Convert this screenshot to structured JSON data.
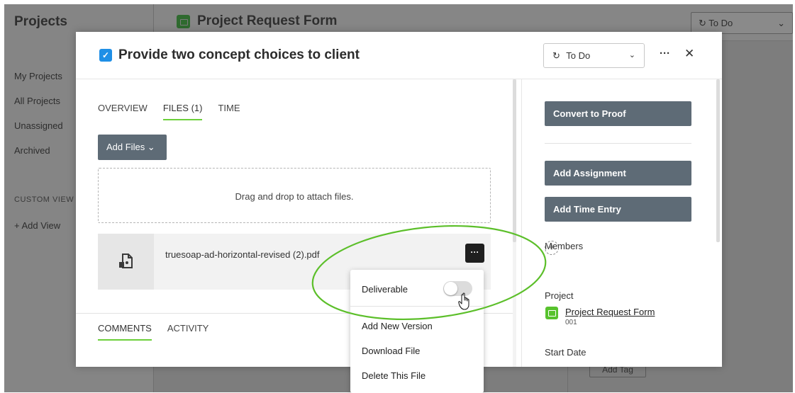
{
  "background": {
    "sidebar_title": "Projects",
    "nav": [
      "My Projects",
      "All Projects",
      "Unassigned",
      "Archived"
    ],
    "custom_views_label": "CUSTOM VIEW",
    "add_view": "+  Add View",
    "project_title": "Project Request Form",
    "status": "To Do",
    "tag_button": "Add Tag"
  },
  "modal": {
    "title": "Provide two concept choices to client",
    "status_select": "To Do",
    "more_label": "···",
    "close_label": "✕",
    "tabs": [
      "OVERVIEW",
      "FILES (1)",
      "TIME"
    ],
    "active_tab": "FILES (1)",
    "add_files_label": "Add Files ⌄",
    "dropzone_text": "Drag and drop to attach files.",
    "file": {
      "name": "truesoap-ad-horizontal-revised (2).pdf",
      "more_label": "···"
    },
    "bottom_tabs": [
      "COMMENTS",
      "ACTIVITY"
    ]
  },
  "right_panel": {
    "convert_to_proof": "Convert to Proof",
    "add_assignment": "Add Assignment",
    "add_time_entry": "Add Time Entry",
    "members_label": "Members",
    "add_member_label": "+",
    "project_label": "Project",
    "project_name": "Project Request Form",
    "project_number": "001",
    "start_date_label": "Start Date"
  },
  "file_menu": {
    "deliverable": "Deliverable",
    "deliverable_on": false,
    "add_new_version": "Add New Version",
    "download_file": "Download File",
    "delete_file": "Delete This File"
  },
  "colors": {
    "accent_green": "#6bcf3a",
    "annotation_green": "#5cbf2a",
    "button_gray": "#5e6b76",
    "task_blue": "#1f8fe6",
    "project_green": "#57c22d"
  },
  "icons": {
    "status": "sync-icon",
    "file": "pdf-file-icon",
    "cursor": "hand-pointer-icon"
  }
}
